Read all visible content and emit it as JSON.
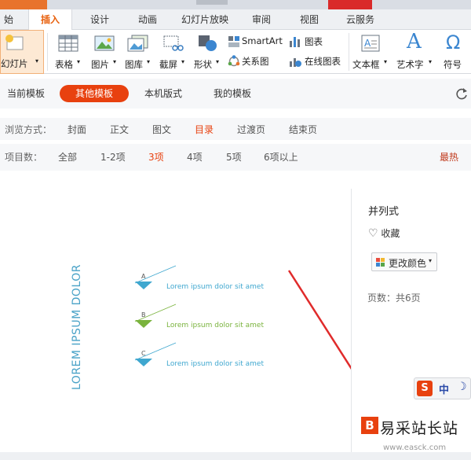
{
  "menu": {
    "tabs": [
      {
        "label": "开始"
      },
      {
        "label": "插入"
      },
      {
        "label": "设计"
      },
      {
        "label": "动画"
      },
      {
        "label": "幻灯片放映"
      },
      {
        "label": "审阅"
      },
      {
        "label": "视图"
      },
      {
        "label": "云服务"
      }
    ],
    "first_tab_visible": "始",
    "active": "插入"
  },
  "ribbon": {
    "new_slide": "幻灯片",
    "table": "表格",
    "picture": "图片",
    "gallery": "图库",
    "screenshot": "截屏",
    "shape": "形状",
    "smartart": "SmartArt",
    "relation": "关系图",
    "chart": "图表",
    "online_chart": "在线图表",
    "textbox": "文本框",
    "wordart": "艺术字",
    "symbol": "符号"
  },
  "template_tabs": {
    "items": [
      "当前模板",
      "其他模板",
      "本机版式",
      "我的模板"
    ],
    "active": "其他模板"
  },
  "browse": {
    "label": "浏览方式：",
    "options": [
      "封面",
      "正文",
      "图文",
      "目录",
      "过渡页",
      "结束页"
    ],
    "selected": "目录"
  },
  "count": {
    "label": "项目数：",
    "options": [
      "全部",
      "1-2项",
      "3项",
      "4项",
      "5项",
      "6项以上"
    ],
    "selected": "3项",
    "sort": "最热"
  },
  "preview": {
    "vertical_title": "LOREM IPSUM DOLOR",
    "items": [
      {
        "letter": "A",
        "text": "Lorem ipsum dolor sit amet",
        "color": "#3fa7cf"
      },
      {
        "letter": "B",
        "text": "Lorem ipsum dolor sit amet",
        "color": "#7ab33d"
      },
      {
        "letter": "C",
        "text": "Lorem ipsum dolor sit amet",
        "color": "#3fa7cf"
      }
    ]
  },
  "detail": {
    "name": "并列式",
    "favorite": "收藏",
    "change_color": "更改颜色",
    "pages": "页数：共6页"
  },
  "ime": {
    "mode": "中"
  },
  "watermark": {
    "text": "易采站长站",
    "url": "www.easck.com"
  },
  "colors": {
    "accent": "#e8410f",
    "tab_active": "#e8600d",
    "teal": "#49a2c7",
    "green": "#7ab33d"
  }
}
